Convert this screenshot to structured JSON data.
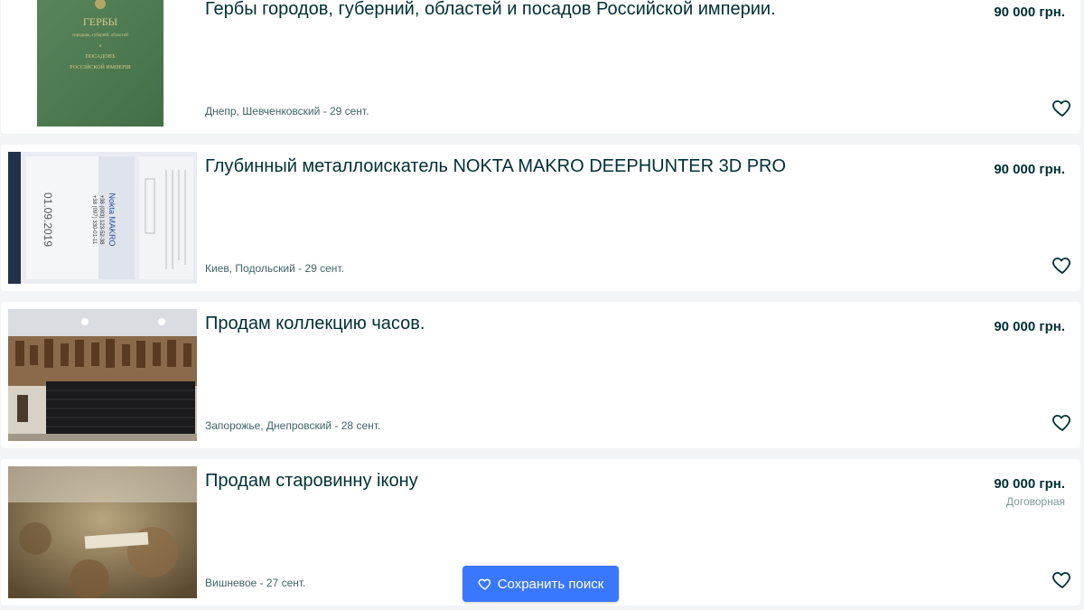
{
  "listings": [
    {
      "title": "Гербы городов, губерний, областей и посадов Российской империи.",
      "location": "Днепр, Шевченковский - 29 сент.",
      "price": "90 000 грн.",
      "thumb_text": [
        "ГЕРБЫ",
        "городовъ, губерній, областей",
        "и",
        "ПОСАДОВЪ",
        "РОССІЙСКОЙ ИМПЕРІИ"
      ]
    },
    {
      "title": "Глубинный металлоискатель NOKTA MAKRO DEEPHUNTER 3D PRO",
      "location": "Киев, Подольский - 29 сент.",
      "price": "90 000 грн.",
      "thumb_text": [
        "01.09.2019",
        "Nokta MAKRO",
        "+38 (093) 123-52-38",
        "+38 (097) 330-01-11"
      ]
    },
    {
      "title": "Продам коллекцию часов.",
      "location": "Запорожье, Днепровский - 28 сент.",
      "price": "90 000 грн."
    },
    {
      "title": "Продам старовинну ікону",
      "location": "Вишневое - 27 сент.",
      "price": "90 000 грн.",
      "negotiable": "Договорная"
    }
  ],
  "save_search": {
    "label": "Сохранить поиск"
  },
  "colors": {
    "background": "#f2f4f5",
    "card": "#ffffff",
    "text": "#002f34",
    "accent_button": "#3a77ff"
  },
  "icons": {
    "favorite": "heart-icon",
    "save": "heart-icon"
  }
}
